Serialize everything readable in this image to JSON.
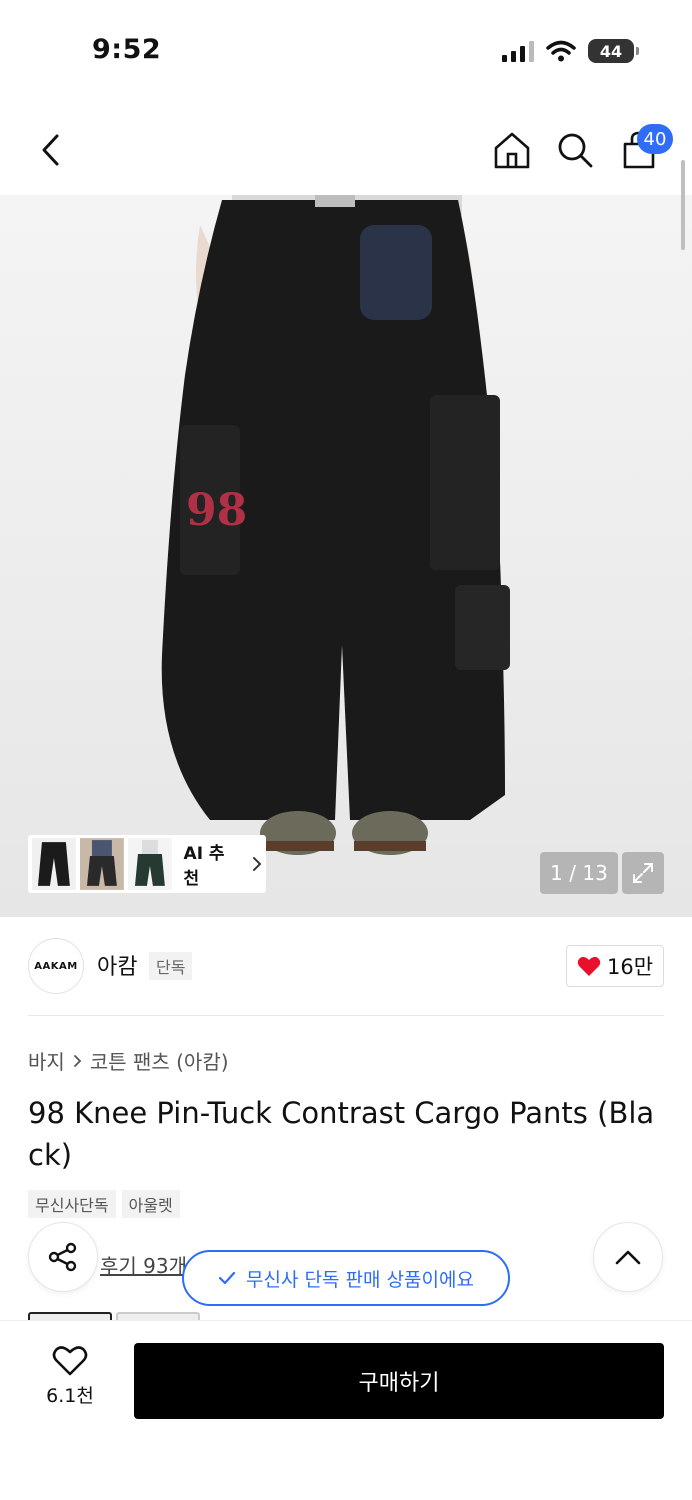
{
  "status_bar": {
    "time": "9:52",
    "battery": "44"
  },
  "header": {
    "cart_count": "40"
  },
  "hero": {
    "ai_label": "AI 추천",
    "page_counter": "1 / 13"
  },
  "brand": {
    "logo_text": "AAKAM",
    "name": "아캄",
    "tag": "단독",
    "likes": "16만"
  },
  "product": {
    "breadcrumb": [
      "바지",
      "코튼 팬츠 (아캄)"
    ],
    "title": "98 Knee Pin-Tuck Contrast Cargo Pants (Black)",
    "tags": [
      "무신사단독",
      "아울렛"
    ],
    "reviews_label": "후기 93개"
  },
  "toast": {
    "message": "무신사 단독 판매 상품이에요"
  },
  "bottom": {
    "wish_count": "6.1천",
    "buy_label": "구매하기"
  },
  "colors": {
    "accent": "#2f6df6",
    "heart": "#e8102a",
    "buy_bg": "#000000"
  },
  "icons": [
    "back-icon",
    "home-icon",
    "search-icon",
    "bag-icon",
    "expand-icon",
    "heart-icon",
    "share-icon",
    "chevron-up-icon",
    "check-icon"
  ]
}
